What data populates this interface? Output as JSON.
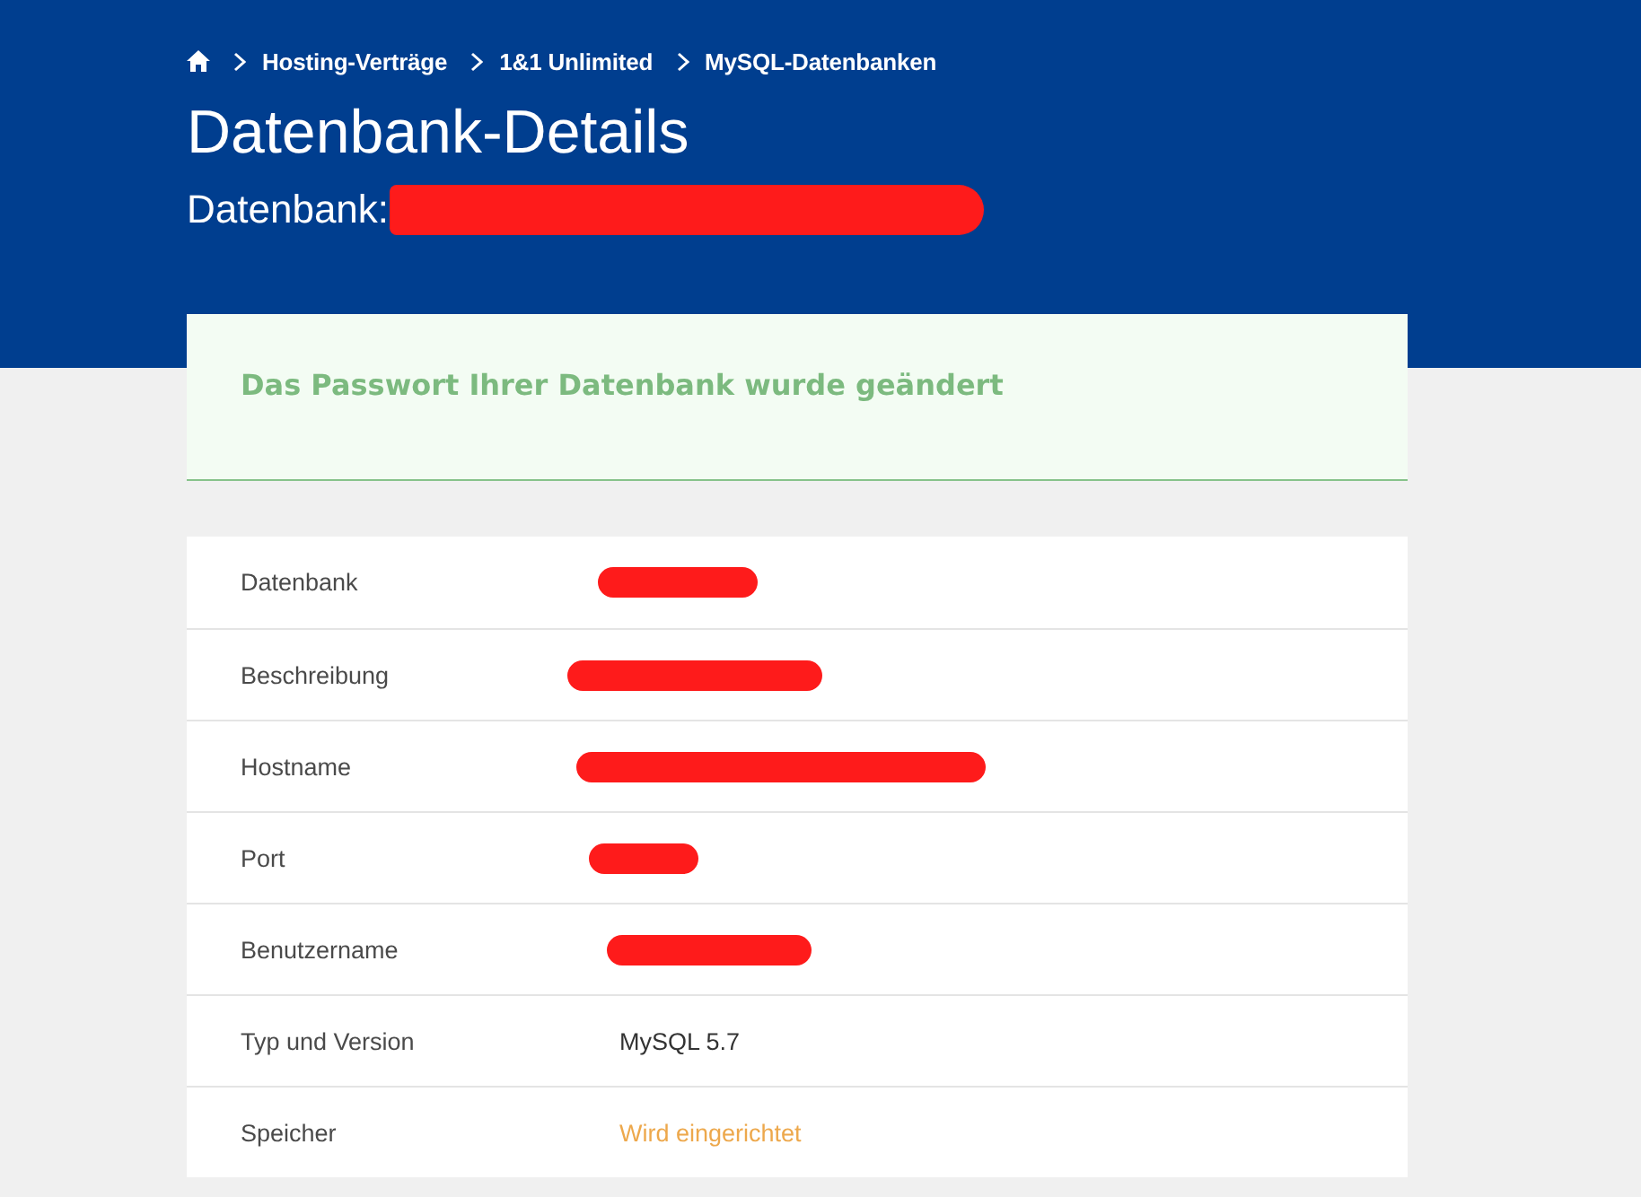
{
  "breadcrumb": [
    "Hosting-Verträge",
    "1&1 Unlimited",
    "MySQL-Datenbanken"
  ],
  "header": {
    "title": "Datenbank-Details",
    "subtitle": {
      "label": "Datenbank:",
      "redacted": true
    }
  },
  "notice": {
    "kind": "success",
    "message": "Das Passwort Ihrer Datenbank wurde geändert"
  },
  "details": [
    {
      "label": "Datenbank",
      "kind": "redacted"
    },
    {
      "label": "Beschreibung",
      "kind": "redacted"
    },
    {
      "label": "Hostname",
      "kind": "redacted"
    },
    {
      "label": "Port",
      "kind": "redacted"
    },
    {
      "label": "Benutzername",
      "kind": "redacted"
    },
    {
      "label": "Typ und Version",
      "kind": "text",
      "value": "MySQL 5.7"
    },
    {
      "label": "Speicher",
      "kind": "pending",
      "value": "Wird eingerichtet"
    }
  ]
}
